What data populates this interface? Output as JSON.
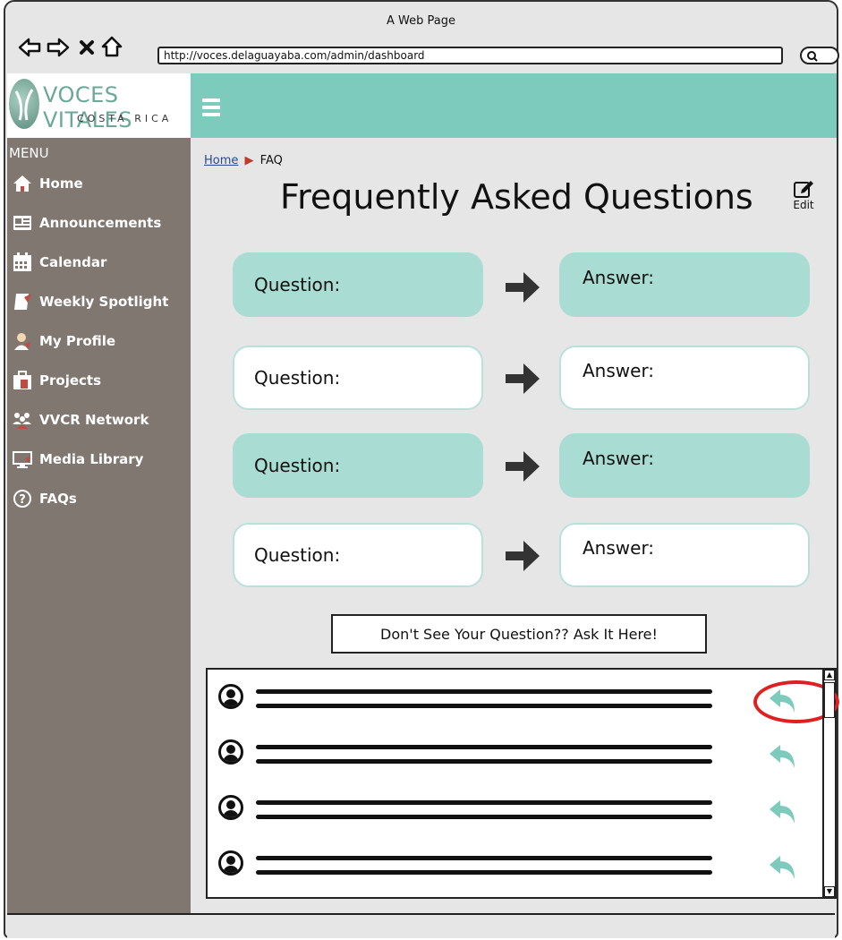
{
  "window": {
    "title": "A Web Page",
    "url": "http://voces.delaguayaba.com/admin/dashboard"
  },
  "brand": {
    "title": "VOCES VITALES",
    "subtitle": "COSTA RICA",
    "accent_color": "#7dcbbd",
    "logo_text_color": "#6aa898"
  },
  "sidebar": {
    "menu_label": "MENU",
    "background": "#807770",
    "items": [
      {
        "label": "Home",
        "icon": "home-icon"
      },
      {
        "label": "Announcements",
        "icon": "announcements-icon"
      },
      {
        "label": "Calendar",
        "icon": "calendar-icon"
      },
      {
        "label": "Weekly Spotlight",
        "icon": "spotlight-icon"
      },
      {
        "label": "My Profile",
        "icon": "profile-icon"
      },
      {
        "label": "Projects",
        "icon": "projects-icon"
      },
      {
        "label": "VVCR Network",
        "icon": "network-icon"
      },
      {
        "label": "Media Library",
        "icon": "media-icon"
      },
      {
        "label": "FAQs",
        "icon": "faq-icon"
      }
    ]
  },
  "breadcrumb": {
    "home": "Home",
    "current": "FAQ"
  },
  "page": {
    "title": "Frequently Asked Questions",
    "edit_label": "Edit"
  },
  "faq": [
    {
      "question": "Question:",
      "answer": "Answer:",
      "style": "teal"
    },
    {
      "question": "Question:",
      "answer": "Answer:",
      "style": "white"
    },
    {
      "question": "Question:",
      "answer": "Answer:",
      "style": "teal"
    },
    {
      "question": "Question:",
      "answer": "Answer:",
      "style": "white"
    }
  ],
  "ask_button": "Don't See Your Question?? Ask It Here!",
  "thread": {
    "reply_icon": "reply-icon",
    "reply_color": "#7dcbbd",
    "highlight_color": "#e02020"
  }
}
